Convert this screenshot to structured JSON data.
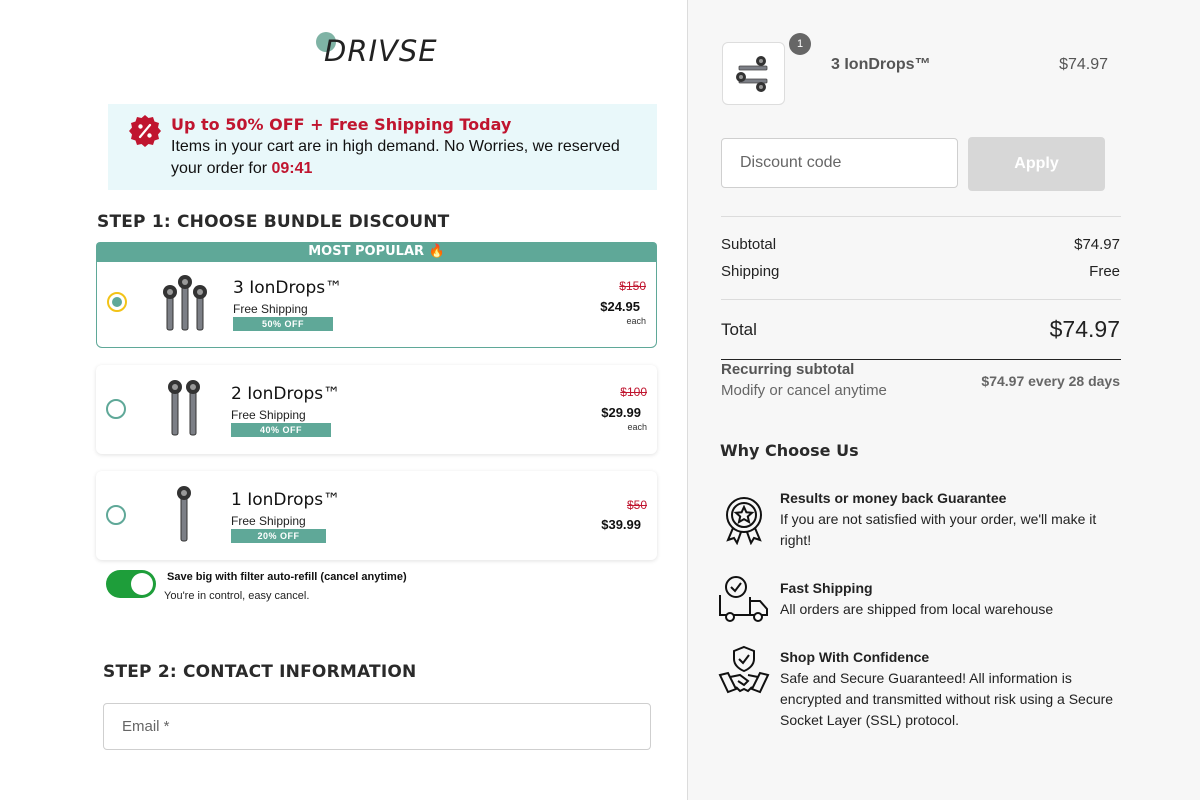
{
  "brand": {
    "name": "DRIVSE"
  },
  "promo": {
    "headline": "Up  to 50%  OFF + Free Shipping Today",
    "body": " Items in your cart are in high demand. No Worries, we reserved your order for ",
    "timer": "09:41"
  },
  "step1": {
    "title": "STEP 1: CHOOSE BUNDLE DISCOUNT",
    "popular_label": "MOST POPULAR 🔥",
    "bundles": [
      {
        "name": "3 IonDrops™",
        "shipping": "Free Shipping",
        "badge": "50% OFF",
        "old_price": "$150",
        "price": "$24.95",
        "unit": "each",
        "selected": true
      },
      {
        "name": "2 IonDrops™",
        "shipping": "Free Shipping",
        "badge": "40% OFF",
        "old_price": "$100",
        "price": "$29.99",
        "unit": "each",
        "selected": false
      },
      {
        "name": "1 IonDrops™",
        "shipping": "Free Shipping",
        "badge": "20% OFF",
        "old_price": "$50",
        "price": "$39.99",
        "unit": "",
        "selected": false
      }
    ],
    "autorefill": {
      "title": "Save big with filter auto-refill (cancel anytime)",
      "subtitle": "You're in control, easy cancel.",
      "enabled": true
    }
  },
  "step2": {
    "title": "STEP 2: CONTACT INFORMATION",
    "email_placeholder": "Email *"
  },
  "summary": {
    "item": {
      "quantity": "1",
      "name": "3 IonDrops™",
      "price": "$74.97"
    },
    "discount_placeholder": "Discount code",
    "apply_label": "Apply",
    "subtotal_label": "Subtotal",
    "subtotal_value": "$74.97",
    "shipping_label": "Shipping",
    "shipping_value": "Free",
    "total_label": "Total",
    "total_value": "$74.97",
    "recurring_label": "Recurring subtotal",
    "recurring_sub": "Modify or cancel anytime",
    "recurring_value": "$74.97 every 28 days"
  },
  "why": {
    "title": "Why Choose Us",
    "features": [
      {
        "icon": "award-badge-icon",
        "title": "Results or money back Guarantee",
        "text": "If you are not satisfied with your order, we'll make it right!"
      },
      {
        "icon": "delivery-truck-icon",
        "title": "Fast Shipping",
        "text": "All orders are shipped from local warehouse"
      },
      {
        "icon": "handshake-shield-icon",
        "title": "Shop With Confidence",
        "text": "Safe and Secure Guaranteed! All information is encrypted and transmitted without risk using a Secure Socket Layer (SSL) protocol."
      }
    ]
  },
  "colors": {
    "accent": "#5fa898",
    "sale_red": "#c0152f",
    "toggle_green": "#1e9e3a",
    "promo_bg": "#e9f8fa"
  }
}
